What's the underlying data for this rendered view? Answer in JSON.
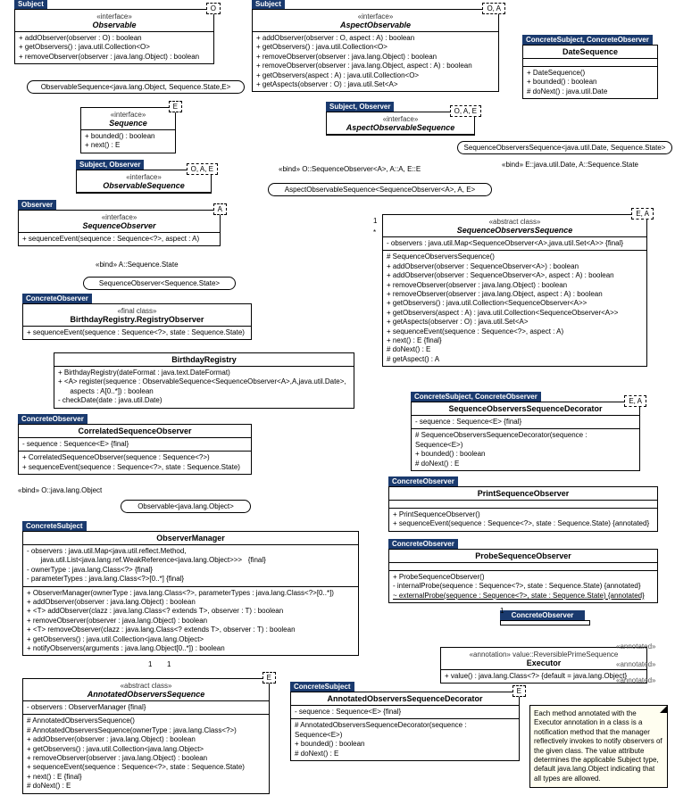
{
  "observable": {
    "tag": "Subject",
    "tpl": "O",
    "stereo": "«interface»",
    "name": "Observable",
    "ops": [
      "+ addObserver(observer : O) : boolean",
      "+ getObservers() : java.util.Collection<O>",
      "+ removeObserver(observer : java.lang.Object) : boolean"
    ]
  },
  "obsSeqBind": "ObservableSequence<java.lang.Object, Sequence.State,E>",
  "sequence": {
    "tpl": "E",
    "stereo": "«interface»",
    "name": "Sequence",
    "ops": [
      "+ bounded() : boolean",
      "+ next() : E"
    ]
  },
  "obsSeq": {
    "tag": "Subject, Observer",
    "tpl": "O, A, E",
    "stereo": "«interface»",
    "name": "ObservableSequence"
  },
  "seqObs": {
    "tag": "Observer",
    "tpl": "A",
    "stereo": "«interface»",
    "name": "SequenceObserver",
    "ops": [
      "+ sequenceEvent(sequence : Sequence<?>, aspect : A)"
    ]
  },
  "bindA": "«bind» A::Sequence.State",
  "seqObsSS": "SequenceObserver<Sequence.State>",
  "registryObs": {
    "tag": "ConcreteObserver",
    "stereo": "«final class»",
    "name": "BirthdayRegistry.RegistryObserver",
    "ops": [
      "+ sequenceEvent(sequence : Sequence<?>, state : Sequence.State)"
    ]
  },
  "birthdayReg": {
    "name": "BirthdayRegistry",
    "ops": [
      "+ BirthdayRegistry(dateFormat : java.text.DateFormat)",
      "+ <A> register(sequence : ObservableSequence<SequenceObserver<A>,A,java.util.Date>,\n      aspects : A[0..*]) : boolean",
      "- checkDate(date : java.util.Date)"
    ]
  },
  "correlObs": {
    "tag": "ConcreteObserver",
    "name": "CorrelatedSequenceObserver",
    "attrs": [
      "- sequence : Sequence<E>   {final}"
    ],
    "ops": [
      "+ CorrelatedSequenceObserver(sequence : Sequence<?>)",
      "+ sequenceEvent(sequence : Sequence<?>, state : Sequence.State)"
    ]
  },
  "bindO": "«bind» O::java.lang.Object",
  "obsJLang": "Observable<java.lang.Object>",
  "obsMgr": {
    "tag": "ConcreteSubject",
    "name": "ObserverManager",
    "attrs": [
      "- observers : java.util.Map<java.util.reflect.Method,\n       java.util.List<java.lang.ref.WeakReference<java.lang.Object>>>   {final}",
      "- ownerType : java.lang.Class<?>   {final}",
      "- parameterTypes : java.lang.Class<?>[0..*]   {final}"
    ],
    "ops": [
      "+ ObserverManager(ownerType : java.lang.Class<?>, parameterTypes : java.lang.Class<?>[0..*])",
      "+ addObserver(observer : java.lang.Object) : boolean",
      "+ <T> addObserver(clazz : java.lang.Class<? extends T>, observer : T) : boolean",
      "+ removeObserver(observer : java.lang.Object) : boolean",
      "+ <T> removeObserver(clazz : java.lang.Class<? extends T>, observer : T) : boolean",
      "+ getObservers() : java.util.Collection<java.lang.Object>",
      "+ notifyObservers(arguments : java.lang.Object[0..*]) : boolean"
    ]
  },
  "annObsSeq": {
    "stereo": "«abstract class»",
    "name": "AnnotatedObserversSequence",
    "tpl": "E",
    "attrs": [
      "- observers : ObserverManager   {final}"
    ],
    "ops": [
      "# AnnotatedObserversSequence()",
      "# AnnotatedObserversSequence(ownerType : java.lang.Class<?>)",
      "+ addObserver(observer : java.lang.Object) : boolean",
      "+ getObservers() : java.util.Collection<java.lang.Object>",
      "+ removeObserver(observer : java.lang.Object) : boolean",
      "+ sequenceEvent(sequence : Sequence<?>, state : Sequence.State)",
      "+ next() : E   {final}",
      "# doNext() : E"
    ]
  },
  "annObsSeqDec": {
    "tag": "ConcreteSubject",
    "name": "AnnotatedObserversSequenceDecorator",
    "tpl": "E",
    "attrs": [
      "- sequence : Sequence<E>   {final}"
    ],
    "ops": [
      "# AnnotatedObserversSequenceDecorator(sequence : Sequence<E>)",
      "+ bounded() : boolean",
      "# doNext() : E"
    ]
  },
  "aspectObs": {
    "tag": "Subject",
    "tpl": "O, A",
    "stereo": "«interface»",
    "name": "AspectObservable",
    "ops": [
      "+ addObserver(observer : O, aspect : A) : boolean",
      "+ getObservers() : java.util.Collection<O>",
      "+ removeObserver(observer : java.lang.Object) : boolean",
      "+ removeObserver(observer : java.lang.Object, aspect : A) : boolean",
      "+ getObservers(aspect : A) : java.util.Collection<O>",
      "+ getAspects(observer : O) : java.util.Set<A>"
    ]
  },
  "aspectObsSeq": {
    "tag": "Subject, Observer",
    "tpl": "O, A, E",
    "stereo": "«interface»",
    "name": "AspectObservableSequence"
  },
  "bindOAE": "«bind» O::SequenceObserver<A>, A::A, E::E",
  "aspectObsSeqBind": "AspectObservableSequence<SequenceObserver<A>, A, E>",
  "dateSeq": {
    "tag": "ConcreteSubject, ConcreteObserver",
    "name": "DateSequence",
    "ops": [
      "+ DateSequence()",
      "+ bounded() : boolean",
      "# doNext() : java.util.Date"
    ]
  },
  "seqObsSeqBind": "SequenceObserversSequence<java.util.Date, Sequence.State>",
  "bindEA": "«bind» E::java.util.Date, A::Sequence.State",
  "seqObsSeq": {
    "stereo": "«abstract class»",
    "name": "SequenceObserversSequence",
    "tpl": "E, A",
    "attrs": [
      "- observers : java.util.Map<SequenceObserver<A>,java.util.Set<A>>   {final}"
    ],
    "ops": [
      "# SequenceObserversSequence()",
      "+ addObserver(observer : SequenceObserver<A>) : boolean",
      "+ addObserver(observer : SequenceObserver<A>, aspect : A) : boolean",
      "+ removeObserver(observer : java.lang.Object) : boolean",
      "+ removeObserver(observer : java.lang.Object, aspect : A) : boolean",
      "+ getObservers() : java.util.Collection<SequenceObserver<A>>",
      "+ getObservers(aspect : A) : java.util.Collection<SequenceObserver<A>>",
      "+ getAspects(observer : O) : java.util.Set<A>",
      "+ sequenceEvent(sequence : Sequence<?>, aspect : A)",
      "+ next() : E   {final}",
      "# doNext() : E",
      "# getAspect() : A"
    ]
  },
  "seqObsSeqDec": {
    "tag": "ConcreteSubject, ConcreteObserver",
    "name": "SequenceObserversSequenceDecorator",
    "tpl": "E, A",
    "attrs": [
      "- sequence : Sequence<E>   {final}"
    ],
    "ops": [
      "# SequenceObserversSequenceDecorator(sequence : Sequence<E>)",
      "+ bounded() : boolean",
      "# doNext() : E"
    ]
  },
  "printObs": {
    "tag": "ConcreteObserver",
    "name": "PrintSequenceObserver",
    "ops": [
      "+ PrintSequenceObserver()",
      "+ sequenceEvent(sequence : Sequence<?>, state : Sequence.State)   {annotated}"
    ]
  },
  "probeObs": {
    "tag": "ConcreteObserver",
    "name": "ProbeSequenceObserver",
    "ops": [
      "+ ProbeSequenceObserver()",
      "- internalProbe(sequence : Sequence<?>, state : Sequence.State)   {annotated}",
      "~ externalProbe(sequence : Sequence<?>, state : Sequence.State)   {annotated}"
    ]
  },
  "concObsTag": "ConcreteObserver",
  "executor": {
    "stereo": "«annotation» value::ReversiblePrimeSequence",
    "name": "Executor",
    "ops": [
      "+ value() : java.lang.Class<?>   {default = java.lang.Object}"
    ]
  },
  "note": "Each method annotated with the Executor annotation in a class is a notification method that the manager reflectively invokes to notify observers of the given class. The value attribute determines the applicable Subject type, default java.lang.Object indicating that all types are allowed.",
  "annoLbl": "«annotated»",
  "mult1": "1",
  "multStar": "*"
}
